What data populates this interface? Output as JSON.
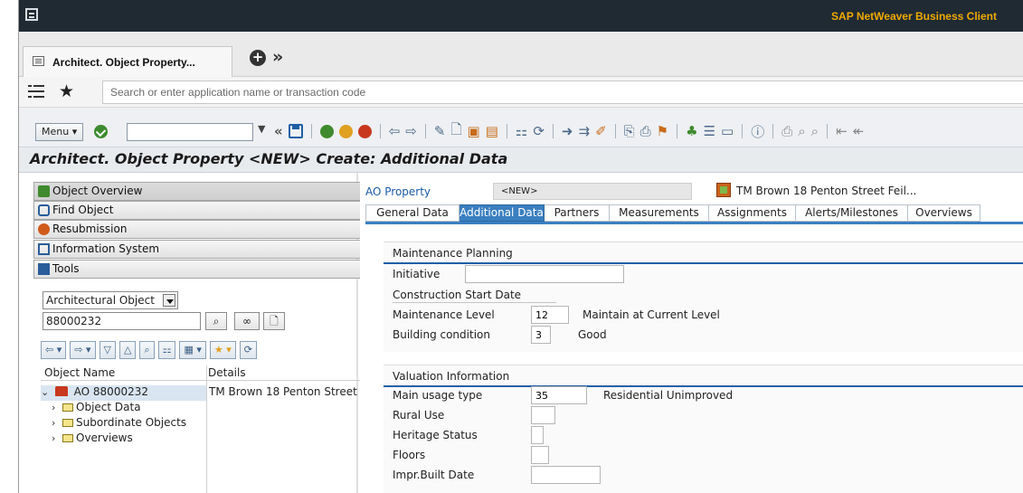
{
  "window": {
    "brand": "SAP NetWeaver Business Client",
    "brand_color": "#f0ab00"
  },
  "tabs_strip": {
    "active_tab": "Architect. Object Property...",
    "more": "»"
  },
  "search": {
    "placeholder": "Search or enter application name or transaction code"
  },
  "toolbar": {
    "menu_label": "Menu",
    "prev_next": "«"
  },
  "page": {
    "title": "Architect. Object Property <NEW> Create: Additional Data"
  },
  "nav": {
    "items": [
      {
        "label": "Object Overview",
        "icon": "object-overview-icon"
      },
      {
        "label": "Find Object",
        "icon": "binoculars-icon"
      },
      {
        "label": "Resubmission",
        "icon": "resubmission-icon"
      },
      {
        "label": "Information System",
        "icon": "info-system-icon"
      },
      {
        "label": "Tools",
        "icon": "tools-icon"
      }
    ],
    "object_type": "Architectural Object",
    "object_id": "88000232"
  },
  "tree": {
    "col_name": "Object Name",
    "col_details": "Details",
    "root": "AO 88000232",
    "root_detail": "TM Brown 18 Penton Street",
    "children": [
      "Object Data",
      "Subordinate Objects",
      "Overviews"
    ]
  },
  "header": {
    "label": "AO Property",
    "value": "<NEW>",
    "description": "TM Brown 18 Penton Street Feil..."
  },
  "detail_tabs": [
    "General Data",
    "Additional Data",
    "Partners",
    "Measurements",
    "Assignments",
    "Alerts/Milestones",
    "Overviews"
  ],
  "maintenance": {
    "title": "Maintenance Planning",
    "initiative_label": "Initiative",
    "initiative_value": "",
    "start_label": "Construction Start Date",
    "level_label": "Maintenance Level",
    "level_value": "12",
    "level_text": "Maintain at Current Level",
    "condition_label": "Building condition",
    "condition_value": "3",
    "condition_text": "Good"
  },
  "valuation": {
    "title": "Valuation Information",
    "usage_label": "Main usage type",
    "usage_value": "35",
    "usage_text": "Residential Unimproved",
    "rural_label": "Rural Use",
    "heritage_label": "Heritage Status",
    "floors_label": "Floors",
    "built_label": "Impr.Built Date"
  }
}
